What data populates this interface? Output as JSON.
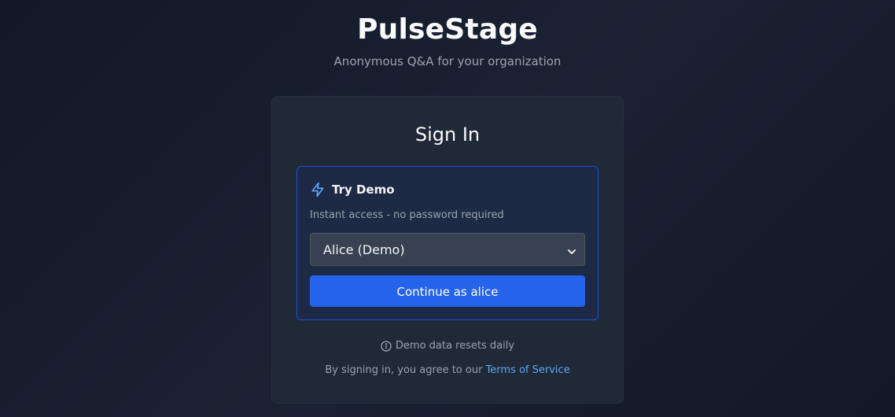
{
  "header": {
    "title": "PulseStage",
    "subtitle": "Anonymous Q&A for your organization"
  },
  "card": {
    "title": "Sign In",
    "demo": {
      "icon": "bolt-icon",
      "label": "Try Demo",
      "description": "Instant access - no password required",
      "select": {
        "value": "Alice (Demo)",
        "icon": "chevron-down-icon"
      },
      "continue_label": "Continue as alice"
    },
    "reset_note": {
      "icon": "info-icon",
      "text": "Demo data resets daily"
    },
    "terms": {
      "prefix": "By signing in, you agree to our ",
      "link": "Terms of Service"
    }
  },
  "colors": {
    "background": "#111827",
    "card": "#1f2937",
    "demo_box": "#1e2a45",
    "demo_border": "#1d4ed8",
    "accent": "#2563eb",
    "link": "#60a5fa",
    "bolt_icon": "#60a5fa",
    "muted_text": "#9ca3af"
  }
}
